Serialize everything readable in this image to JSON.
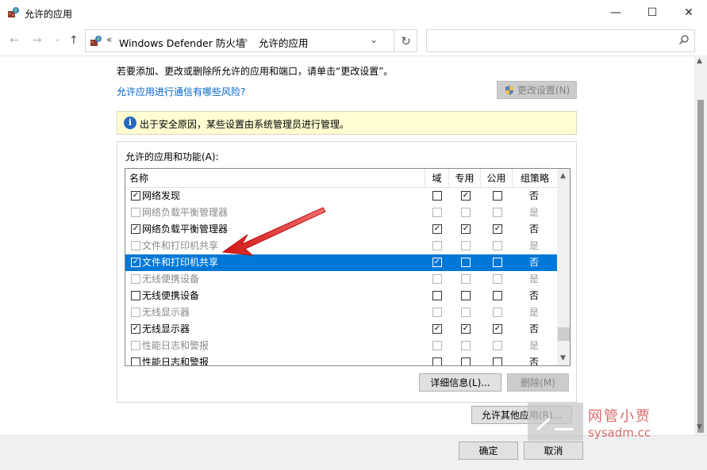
{
  "window": {
    "title": "允许的应用",
    "minimize": "—",
    "maximize": "☐",
    "close": "✕"
  },
  "nav": {
    "back": "←",
    "forward": "→",
    "recent": "⌄",
    "up": "↑"
  },
  "address": {
    "separator": "«",
    "crumb1": "Windows Defender 防火墙",
    "arrow": "›",
    "crumb2": "允许的应用",
    "dropdown": "⌄",
    "refresh": "↻"
  },
  "search": {
    "placeholder": "",
    "icon": "search-icon"
  },
  "intro_text": "若要添加、更改或删除所允许的应用和端口，请单击“更改设置”。",
  "risk_link": "允许应用进行通信有哪些风险?",
  "change_settings": "更改设置(N)",
  "info_text": "出于安全原因，某些设置由系统管理员进行管理。",
  "group_label": "允许的应用和功能(A):",
  "columns": {
    "name": "名称",
    "domain": "域",
    "private": "专用",
    "public": "公用",
    "group_policy": "组策略"
  },
  "rows": [
    {
      "name": "网络发现",
      "enabled": true,
      "domain": false,
      "private": true,
      "public": false,
      "gp": "否",
      "dim": false,
      "selected": false
    },
    {
      "name": "网络负载平衡管理器",
      "enabled": false,
      "domain": false,
      "private": false,
      "public": false,
      "gp": "是",
      "dim": true,
      "selected": false
    },
    {
      "name": "网络负载平衡管理器",
      "enabled": true,
      "domain": true,
      "private": true,
      "public": true,
      "gp": "否",
      "dim": false,
      "selected": false
    },
    {
      "name": "文件和打印机共享",
      "enabled": false,
      "domain": false,
      "private": false,
      "public": false,
      "gp": "是",
      "dim": true,
      "selected": false
    },
    {
      "name": "文件和打印机共享",
      "enabled": true,
      "domain": true,
      "private": false,
      "public": false,
      "gp": "否",
      "dim": false,
      "selected": true
    },
    {
      "name": "无线便携设备",
      "enabled": false,
      "domain": false,
      "private": false,
      "public": false,
      "gp": "是",
      "dim": true,
      "selected": false
    },
    {
      "name": "无线便携设备",
      "enabled": false,
      "domain": false,
      "private": false,
      "public": false,
      "gp": "否",
      "dim": false,
      "selected": false
    },
    {
      "name": "无线显示器",
      "enabled": false,
      "domain": false,
      "private": false,
      "public": false,
      "gp": "是",
      "dim": true,
      "selected": false
    },
    {
      "name": "无线显示器",
      "enabled": true,
      "domain": true,
      "private": true,
      "public": true,
      "gp": "否",
      "dim": false,
      "selected": false
    },
    {
      "name": "性能日志和警报",
      "enabled": false,
      "domain": false,
      "private": false,
      "public": false,
      "gp": "是",
      "dim": true,
      "selected": false
    },
    {
      "name": "性能日志和警报",
      "enabled": false,
      "domain": false,
      "private": false,
      "public": false,
      "gp": "否",
      "dim": false,
      "selected": false
    }
  ],
  "buttons": {
    "details": "详细信息(L)...",
    "delete": "删除(M)",
    "allow_other": "允许其他应用(R)...",
    "ok": "确定",
    "cancel": "取消"
  },
  "watermark": {
    "title": "网管小贾",
    "site": "sysadm.cc"
  },
  "colors": {
    "selection": "#0078d7",
    "link": "#0066cc",
    "info_bg": "#fffdd1",
    "annotation_arrow": "#e02020"
  }
}
